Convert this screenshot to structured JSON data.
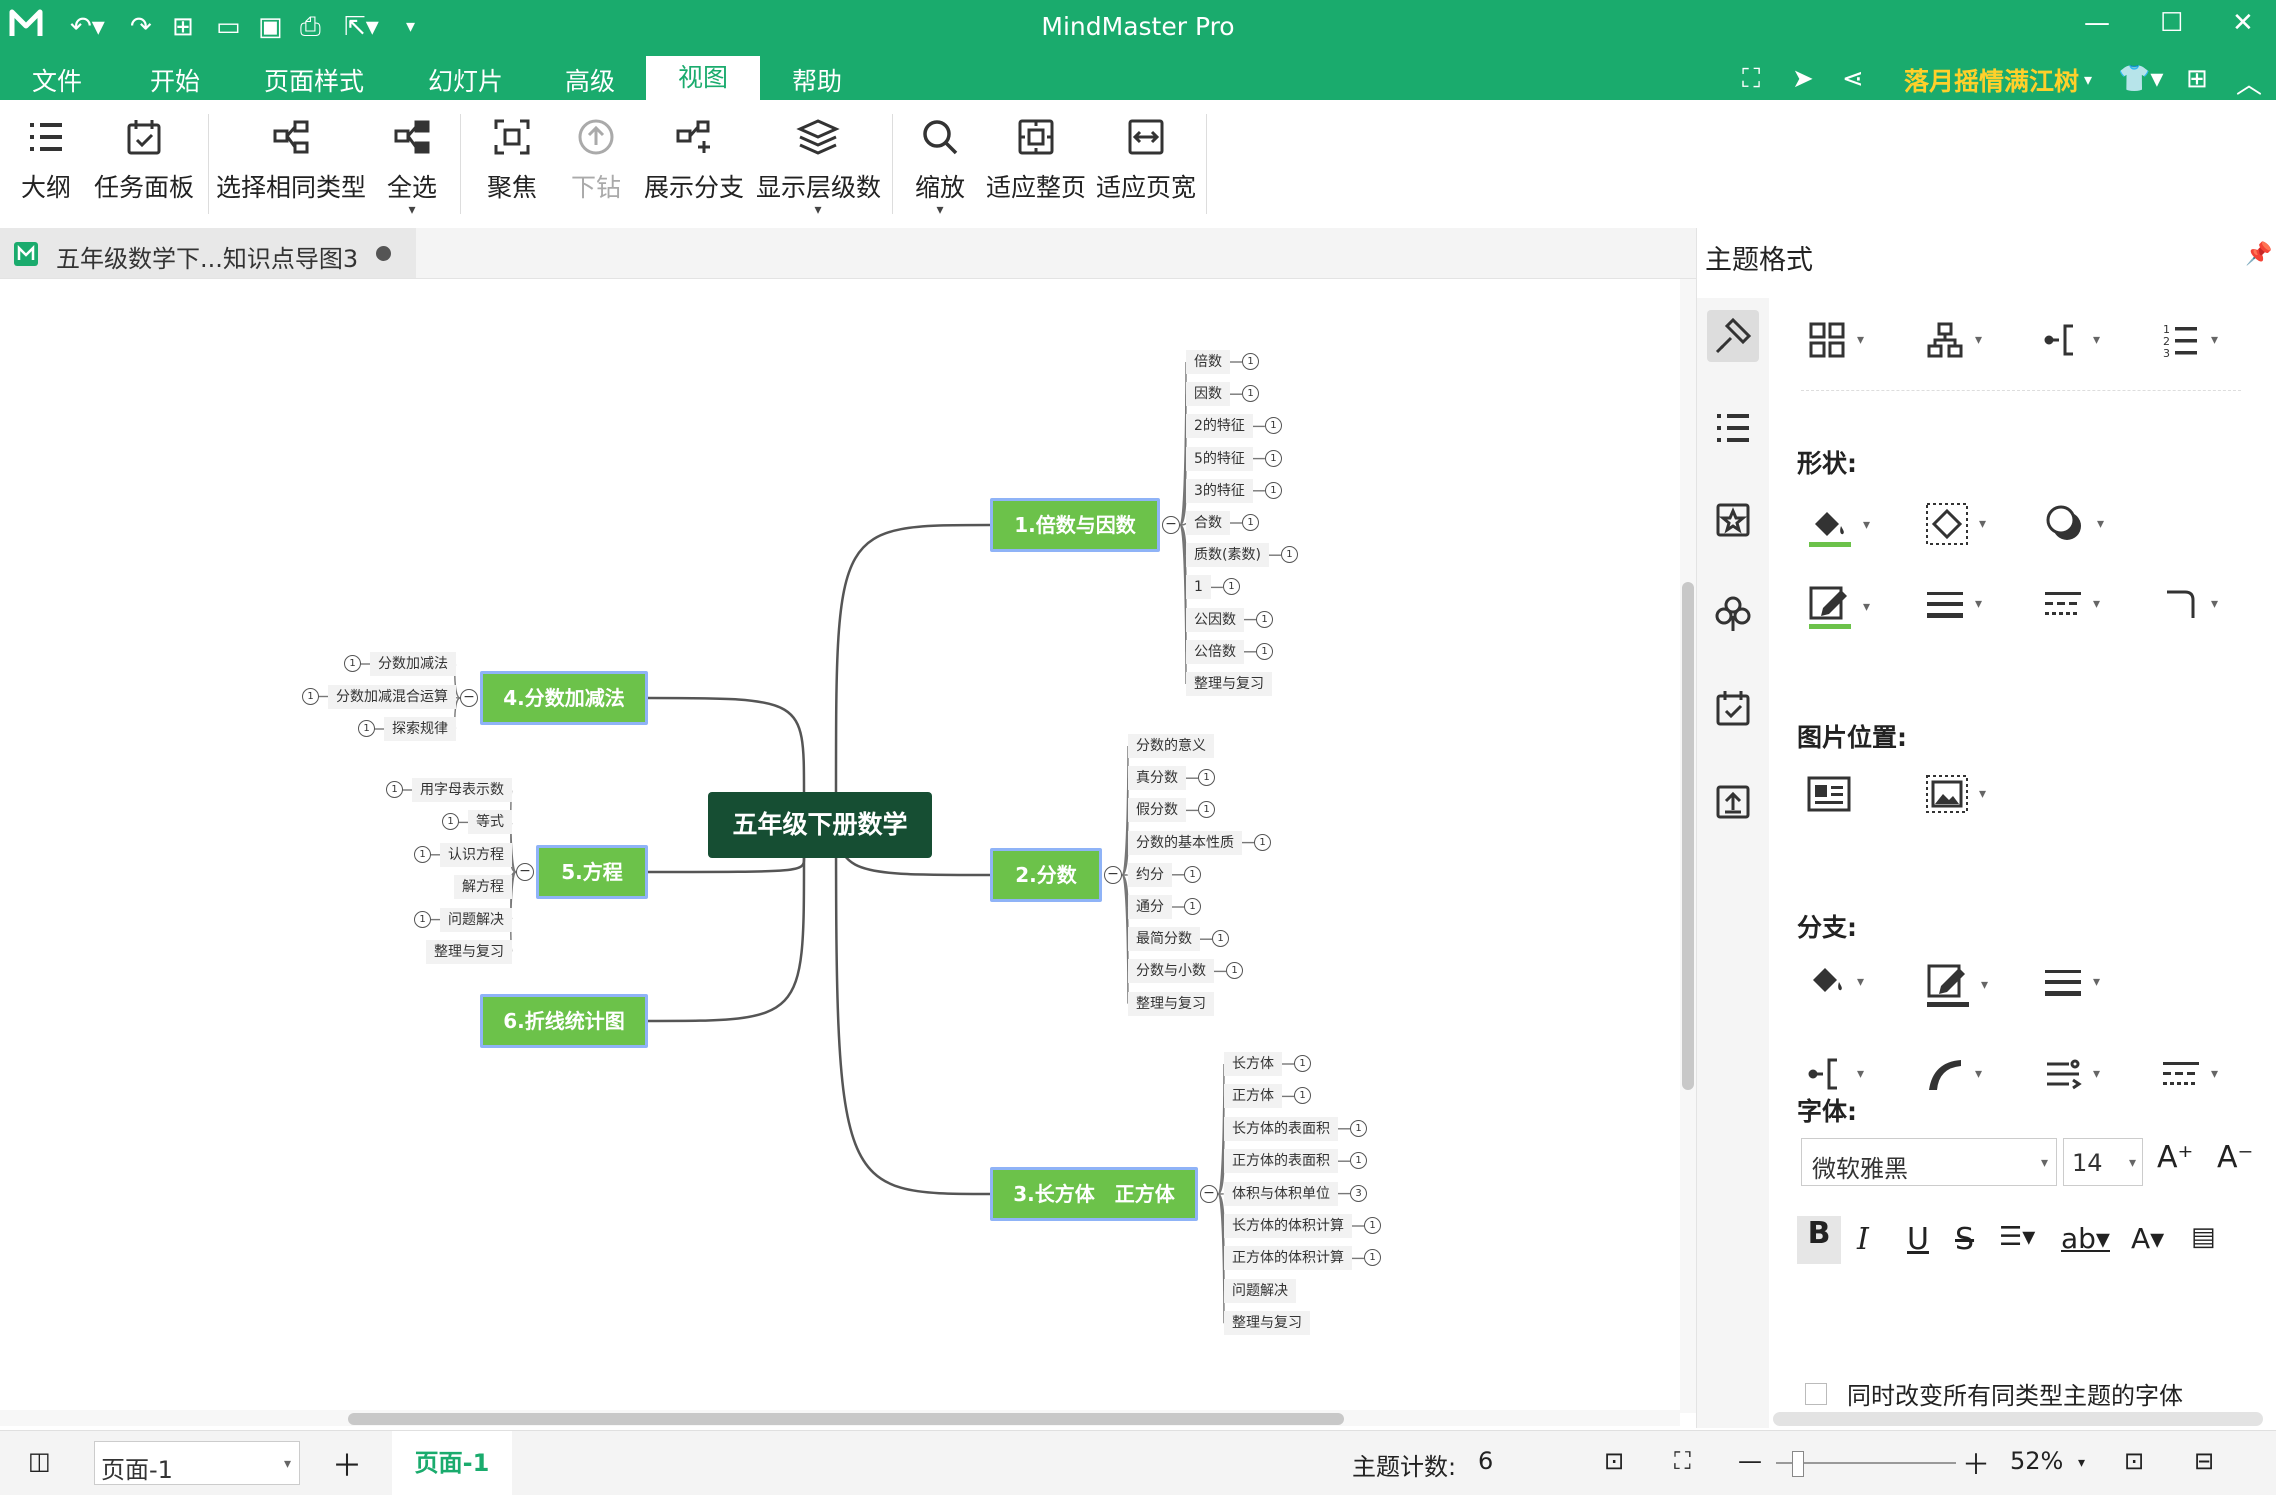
{
  "app": {
    "title": "MindMaster Pro",
    "brand_color": "#1aab6d"
  },
  "quick_access": {
    "icons": [
      "app-logo-icon",
      "undo-icon",
      "redo-icon",
      "new-icon",
      "open-icon",
      "save-icon",
      "print-icon",
      "export-icon",
      "customize-icon"
    ]
  },
  "menu": {
    "items": [
      "文件",
      "开始",
      "页面样式",
      "幻灯片",
      "高级",
      "视图",
      "帮助"
    ],
    "active": "视图",
    "user": "落月摇情满江树"
  },
  "ribbon": {
    "tools": [
      {
        "label": "大纲",
        "icon": "outline-icon"
      },
      {
        "label": "任务面板",
        "icon": "task-panel-icon"
      },
      {
        "label": "选择相同类型",
        "icon": "select-same-type-icon"
      },
      {
        "label": "全选",
        "icon": "select-all-icon"
      },
      {
        "label": "聚焦",
        "icon": "focus-icon"
      },
      {
        "label": "下钻",
        "icon": "drill-down-icon"
      },
      {
        "label": "展示分支",
        "icon": "show-branch-icon"
      },
      {
        "label": "显示层级数",
        "icon": "show-levels-icon"
      },
      {
        "label": "缩放",
        "icon": "zoom-icon"
      },
      {
        "label": "适应整页",
        "icon": "fit-page-icon"
      },
      {
        "label": "适应页宽",
        "icon": "fit-width-icon"
      }
    ]
  },
  "document_tab": {
    "name": "五年级数学下...知识点导图3"
  },
  "mindmap": {
    "root": "五年级下册数学",
    "branches": [
      {
        "label": "1.倍数与因数",
        "leaves": [
          "倍数",
          "因数",
          "2的特征",
          "5的特征",
          "3的特征",
          "合数",
          "质数(素数)",
          "1",
          "公因数",
          "公倍数",
          "整理与复习"
        ]
      },
      {
        "label": "2.分数",
        "leaves": [
          "分数的意义",
          "真分数",
          "假分数",
          "分数的基本性质",
          "约分",
          "通分",
          "最简分数",
          "分数与小数",
          "整理与复习"
        ]
      },
      {
        "label": "3.长方体　正方体",
        "leaves": [
          "长方体",
          "正方体",
          "长方体的表面积",
          "正方体的表面积",
          "体积与体积单位",
          "长方体的体积计算",
          "正方体的体积计算",
          "问题解决",
          "整理与复习"
        ]
      },
      {
        "label": "4.分数加减法",
        "leaves": [
          "分数加减法",
          "分数加减混合运算",
          "探索规律"
        ]
      },
      {
        "label": "5.方程",
        "leaves": [
          "用字母表示数",
          "等式",
          "认识方程",
          "解方程",
          "问题解决",
          "整理与复习"
        ]
      },
      {
        "label": "6.折线统计图",
        "leaves": []
      }
    ],
    "badge_value": "1",
    "badge_value_alt": "3"
  },
  "panel": {
    "title": "主题格式",
    "sections": {
      "shape": "形状:",
      "image_position": "图片位置:",
      "branch": "分支:",
      "font": "字体:"
    },
    "font_family": "微软雅黑",
    "font_size": "14",
    "sync_font_label": "同时改变所有同类型主题的字体",
    "fill_accent": "#6cc24a"
  },
  "status": {
    "page_select": "页面-1",
    "page_tab": "页面-1",
    "topic_count_label": "主题计数:",
    "topic_count": "6",
    "zoom": "52%"
  }
}
